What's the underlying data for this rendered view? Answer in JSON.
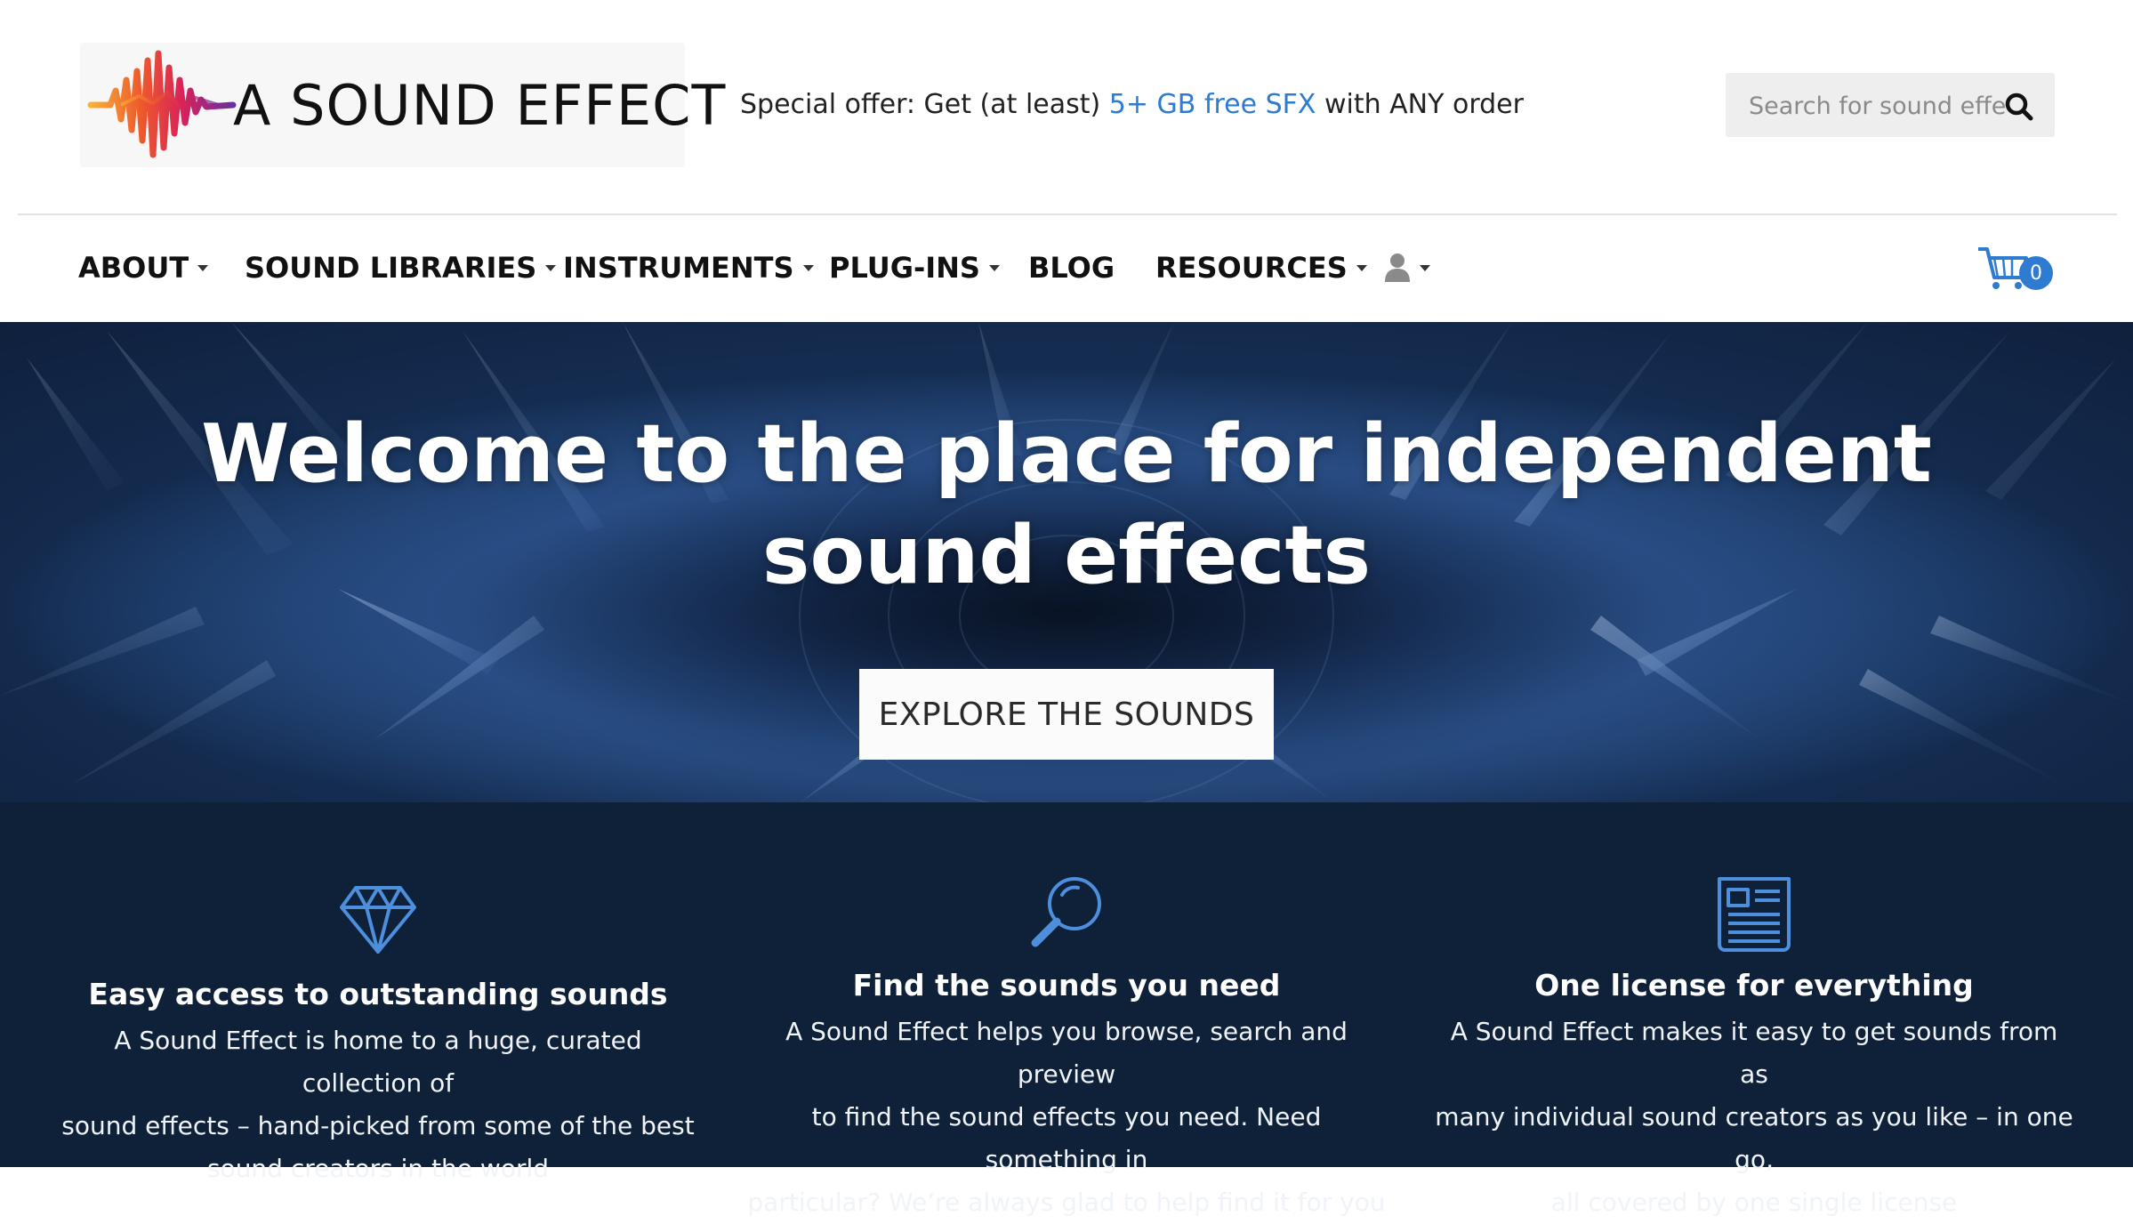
{
  "header": {
    "logo_text": "A SOUND EFFECT",
    "promo": {
      "prefix": "Special offer: Get (at least) ",
      "link": "5+ GB free SFX",
      "suffix": " with ANY order"
    },
    "search": {
      "placeholder": "Search for sound effects"
    }
  },
  "nav": {
    "items": [
      {
        "label": "ABOUT",
        "has_dropdown": true
      },
      {
        "label": "SOUND LIBRARIES",
        "has_dropdown": true
      },
      {
        "label": "INSTRUMENTS",
        "has_dropdown": true
      },
      {
        "label": "PLUG-INS",
        "has_dropdown": true
      },
      {
        "label": "BLOG",
        "has_dropdown": false
      },
      {
        "label": "RESOURCES",
        "has_dropdown": true
      }
    ],
    "account_icon": "user-icon",
    "cart": {
      "icon": "cart-icon",
      "count": "0"
    }
  },
  "hero": {
    "title_line1": "Welcome to the place for independent",
    "title_line2": "sound effects",
    "cta": "EXPLORE THE SOUNDS"
  },
  "features": [
    {
      "icon": "diamond-icon",
      "title": "Easy access to outstanding sounds",
      "lines": [
        "A Sound Effect is home to a huge, curated collection of",
        "sound effects – hand-picked from some of the best",
        "sound creators in the world"
      ]
    },
    {
      "icon": "magnifier-icon",
      "title": "Find the sounds you need",
      "lines": [
        "A Sound Effect helps you browse, search and preview",
        "to find the sound effects you need.  Need something in",
        "particular? We’re always glad to help find it for you"
      ]
    },
    {
      "icon": "document-icon",
      "title": "One license for everything",
      "lines": [
        "A Sound Effect makes it easy to get sounds from as",
        "many individual sound creators as you like – in one go,",
        "all covered by one single license"
      ]
    }
  ],
  "colors": {
    "accent": "#2f7bd1",
    "feature_bg": "#0f2138",
    "feature_icon": "#4d8fdc"
  }
}
